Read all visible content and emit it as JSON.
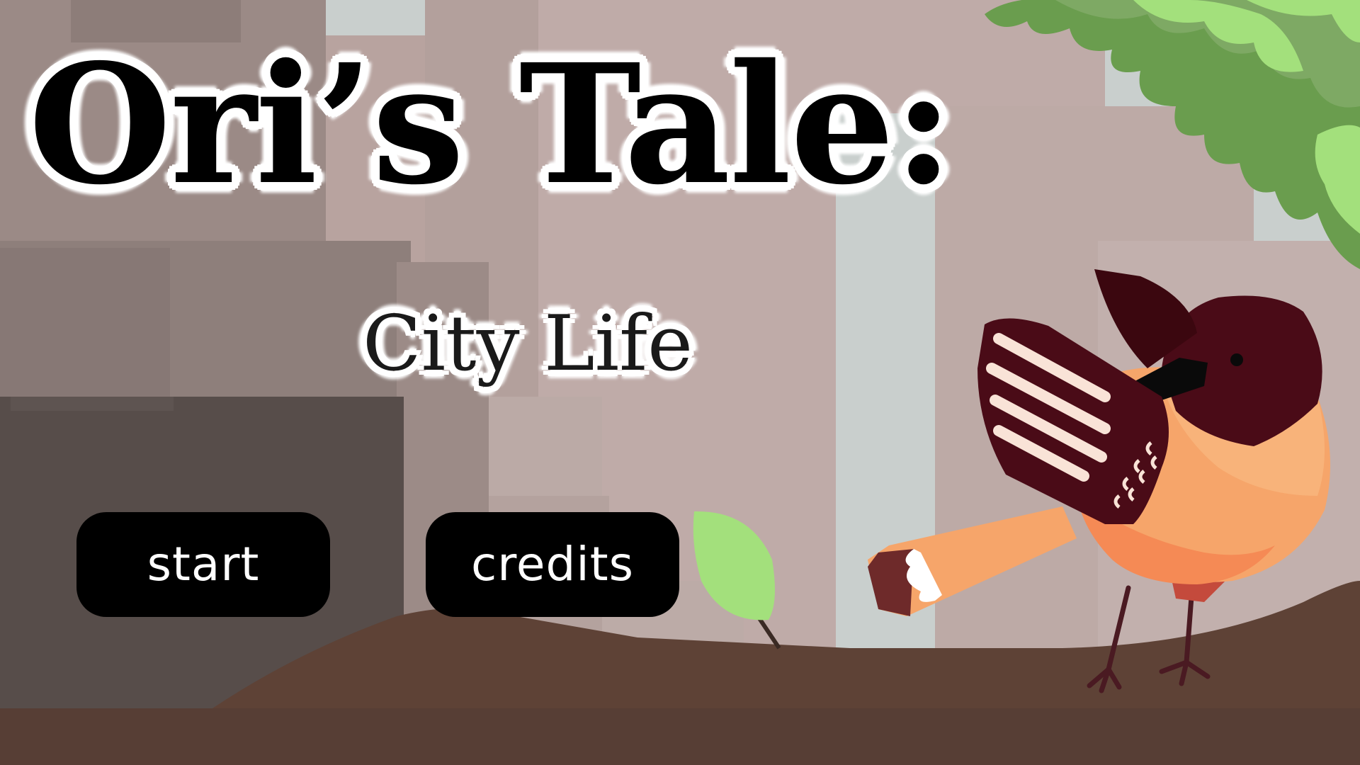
{
  "title": {
    "main": "Ori’s Tale:",
    "subtitle": "City Life"
  },
  "menu": {
    "start_label": "start",
    "credits_label": "credits"
  },
  "colors": {
    "sky": "#c9cfcd",
    "ground": "#5e4236",
    "ground_dark": "#573e35",
    "button_bg": "#000000",
    "button_text": "#ffffff",
    "bird_body": "#f6a56a",
    "bird_head": "#4a0b17",
    "leaf_light": "#a3e07c",
    "leaf_dark": "#6a9d4e"
  }
}
